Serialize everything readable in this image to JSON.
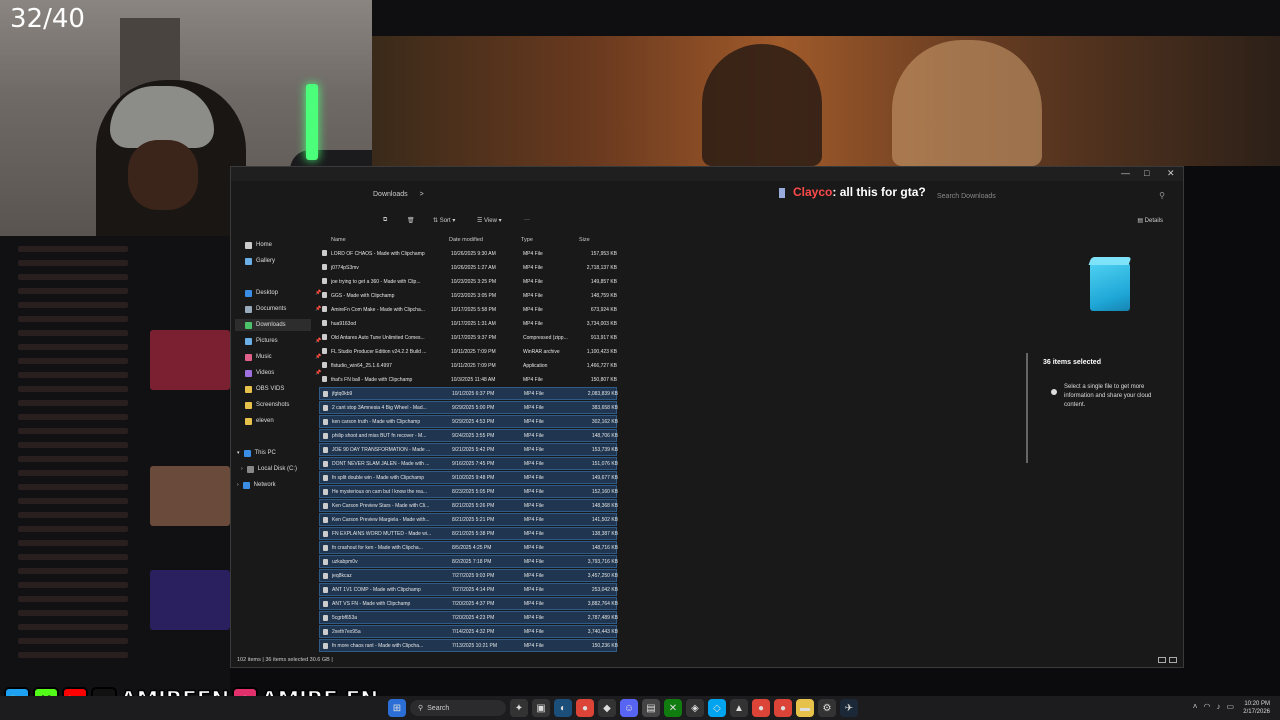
{
  "overlay": {
    "counter": "32/40",
    "chat_user": "Clayco",
    "chat_message": ": all this for gta?"
  },
  "window": {
    "address": "Downloads",
    "address_chevron": ">",
    "search_placeholder": "Search Downloads",
    "minimize": "—",
    "maximize": "□",
    "close": "✕"
  },
  "toolbar": {
    "sort": "Sort",
    "view": "View",
    "more": "···",
    "details": "Details"
  },
  "nav": {
    "items": [
      "Home",
      "Gallery",
      "Desktop",
      "Documents",
      "Downloads",
      "Pictures",
      "Music",
      "Videos",
      "OBS VIDS",
      "Screenshots",
      "eleven",
      "This PC",
      "Local Disk (C:)",
      "Network"
    ]
  },
  "columns": {
    "name": "Name",
    "date": "Date modified",
    "type": "Type",
    "size": "Size"
  },
  "files": [
    {
      "name": "LORD OF CHAOS - Made with Clipchamp",
      "date": "10/26/2025 9:30 AM",
      "type": "MP4 File",
      "size": "157,953 KB",
      "selected": false
    },
    {
      "name": "j0774pS3mv",
      "date": "10/26/2025 1:27 AM",
      "type": "MP4 File",
      "size": "2,718,137 KB",
      "selected": false
    },
    {
      "name": "joe trying to get a 360 - Made with Clip...",
      "date": "10/23/2025 3:25 PM",
      "type": "MP4 File",
      "size": "149,857 KB",
      "selected": false
    },
    {
      "name": "GGS - Made with Clipchamp",
      "date": "10/23/2025 3:05 PM",
      "type": "MP4 File",
      "size": "148,759 KB",
      "selected": false
    },
    {
      "name": "AmireFn Com Make - Made with Clipcha...",
      "date": "10/17/2025 5:58 PM",
      "type": "MP4 File",
      "size": "673,924 KB",
      "selected": false
    },
    {
      "name": "hua9163od",
      "date": "10/17/2025 1:31 AM",
      "type": "MP4 File",
      "size": "3,734,003 KB",
      "selected": false
    },
    {
      "name": "Old Antares Auto Tune Unlimited Comes...",
      "date": "10/17/2025 9:37 PM",
      "type": "Compressed (zipp...",
      "size": "913,917 KB",
      "selected": false
    },
    {
      "name": "FL Studio Producer Edition v24.2.2 Build ...",
      "date": "10/11/2025 7:09 PM",
      "type": "WinRAR archive",
      "size": "1,100,423 KB",
      "selected": false
    },
    {
      "name": "flstudio_win64_25.1.6.4997",
      "date": "10/11/2025 7:09 PM",
      "type": "Application",
      "size": "1,466,727 KB",
      "selected": false
    },
    {
      "name": "that's FN ball - Made with Clipchamp",
      "date": "10/3/2025 11:48 AM",
      "type": "MP4 File",
      "size": "150,807 KB",
      "selected": false
    },
    {
      "name": "jfgtq0kb9",
      "date": "10/1/2025 6:37 PM",
      "type": "MP4 File",
      "size": "2,083,839 KB",
      "selected": true
    },
    {
      "name": "2 cant stop 3Amnesia 4 Big Wheel - Mad...",
      "date": "9/29/2025 5:00 PM",
      "type": "MP4 File",
      "size": "383,658 KB",
      "selected": true
    },
    {
      "name": "ken carson truth - Made with Clipchamp",
      "date": "9/29/2025 4:53 PM",
      "type": "MP4 File",
      "size": "302,162 KB",
      "selected": true
    },
    {
      "name": "philip shoot and miss BUT fn recover - M...",
      "date": "9/24/2025 3:55 PM",
      "type": "MP4 File",
      "size": "148,706 KB",
      "selected": true
    },
    {
      "name": "JOE 90 DAY TRANSFORMATION - Made ...",
      "date": "9/21/2025 5:42 PM",
      "type": "MP4 File",
      "size": "153,739 KB",
      "selected": true
    },
    {
      "name": "DONT NEVER SLAM JALEN - Made with ...",
      "date": "9/16/2025 7:45 PM",
      "type": "MP4 File",
      "size": "151,076 KB",
      "selected": true
    },
    {
      "name": "fn split double win - Made with Clipchamp",
      "date": "9/10/2025 9:48 PM",
      "type": "MP4 File",
      "size": "149,677 KB",
      "selected": true
    },
    {
      "name": "He mysterious on cam but I know the rea...",
      "date": "8/23/2025 5:05 PM",
      "type": "MP4 File",
      "size": "152,160 KB",
      "selected": true
    },
    {
      "name": "Ken Carson Preview Stars - Made with Cli...",
      "date": "8/21/2025 5:26 PM",
      "type": "MP4 File",
      "size": "148,368 KB",
      "selected": true
    },
    {
      "name": "Ken Carson Preview Margiela - Made with...",
      "date": "8/21/2025 5:21 PM",
      "type": "MP4 File",
      "size": "141,502 KB",
      "selected": true
    },
    {
      "name": "FN EXPLAINS WORD MUTTED - Made wi...",
      "date": "8/21/2025 5:38 PM",
      "type": "MP4 File",
      "size": "138,387 KB",
      "selected": true
    },
    {
      "name": "fn crashout for ken - Made with Clipcha...",
      "date": "8/5/2025 4:25 PM",
      "type": "MP4 File",
      "size": "148,716 KB",
      "selected": true
    },
    {
      "name": "uzkabpm0v",
      "date": "8/2/2025 7:18 PM",
      "type": "MP4 File",
      "size": "3,793,716 KB",
      "selected": true
    },
    {
      "name": "jeq8kcaz",
      "date": "7/27/2025 9:03 PM",
      "type": "MP4 File",
      "size": "3,457,250 KB",
      "selected": true
    },
    {
      "name": "ANT 1V1 COMP - Made with Clipchamp",
      "date": "7/27/2025 4:14 PM",
      "type": "MP4 File",
      "size": "253,042 KB",
      "selected": true
    },
    {
      "name": "ANT VS FN - Made with Clipchamp",
      "date": "7/20/2025 4:37 PM",
      "type": "MP4 File",
      "size": "3,882,764 KB",
      "selected": true
    },
    {
      "name": "5cgrbf653a",
      "date": "7/20/2025 4:23 PM",
      "type": "MP4 File",
      "size": "2,787,489 KB",
      "selected": true
    },
    {
      "name": "2xeth7ex95a",
      "date": "7/14/2025 4:32 PM",
      "type": "MP4 File",
      "size": "3,740,443 KB",
      "selected": true
    },
    {
      "name": "fn more chaos rant - Made with Clipcha...",
      "date": "7/13/2025 10:21 PM",
      "type": "MP4 File",
      "size": "150,236 KB",
      "selected": true
    }
  ],
  "details": {
    "items_selected": "36 items selected",
    "info": "Select a single file to get more information and share your cloud content."
  },
  "status": {
    "text": "102 items  |  36 items selected 30.6 GB  |"
  },
  "social": {
    "handle1": "AMIREFN",
    "handle2": "AMIRE.FN"
  },
  "taskbar": {
    "search": "Search",
    "time": "10:20 PM",
    "date": "2/17/2026"
  }
}
